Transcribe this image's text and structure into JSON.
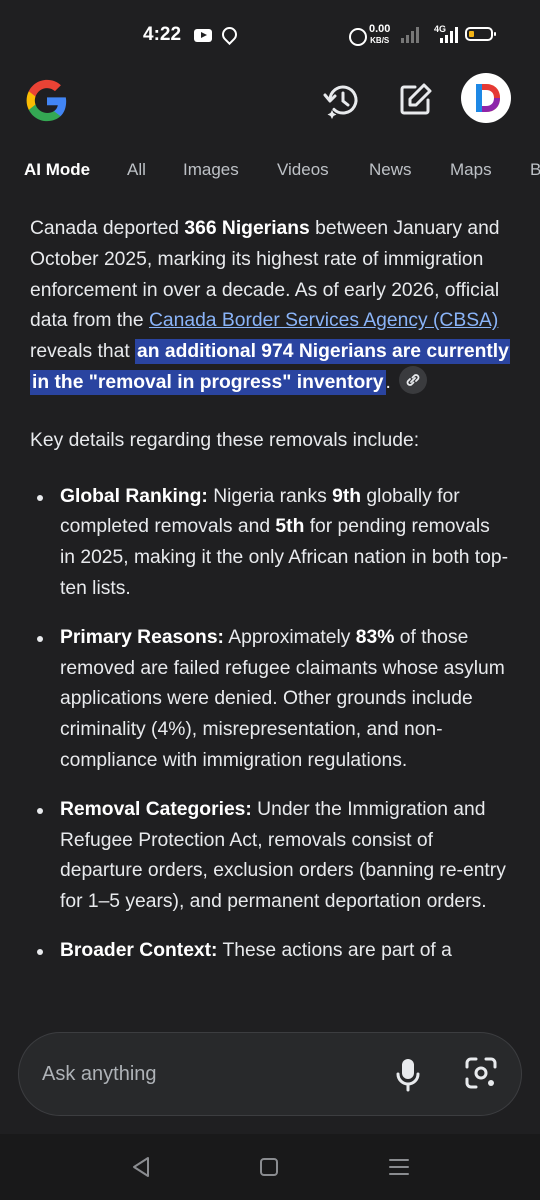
{
  "status_bar": {
    "time": "4:22",
    "speed_value": "0.00",
    "speed_unit": "KB/S",
    "network": "4G",
    "icons": [
      "youtube-icon",
      "location-icon",
      "alarm-icon",
      "signal-icon",
      "battery-icon"
    ]
  },
  "header": {
    "logo": "google-logo",
    "icons": [
      "history-icon",
      "edit-icon",
      "avatar"
    ],
    "avatar_letter": "D"
  },
  "tabs": [
    "AI Mode",
    "All",
    "Images",
    "Videos",
    "News",
    "Maps",
    "B"
  ],
  "active_tab": "AI Mode",
  "content": {
    "p1_a": "Canada deported ",
    "p1_b": "366 Nigerians",
    "p1_c": " between January and October 2025, marking its highest rate of immigration enforcement in over a decade. As of early 2026, official data from the ",
    "p1_link": "Canada Border Services Agency (CBSA)",
    "p1_d": " reveals that ",
    "p1_highlight": "an additional 974 Nigerians are currently in the \"removal in progress\" inventory",
    "p1_e": ".",
    "p2": "Key details regarding these removals include:",
    "bullets": [
      {
        "title": "Global Ranking:",
        "parts": [
          " Nigeria ranks ",
          "9th",
          " globally for completed removals and ",
          "5th",
          " for pending removals in 2025, making it the only African nation in both top-ten lists."
        ]
      },
      {
        "title": "Primary Reasons:",
        "parts": [
          " Approximately ",
          "83%",
          " of those removed are failed refugee claimants whose asylum applications were denied. Other grounds include criminality (4%), misrepresentation, and non-compliance with immigration regulations."
        ]
      },
      {
        "title": "Removal Categories:",
        "text": " Under the Immigration and Refugee Protection Act, removals consist of departure orders, exclusion orders (banning re-entry for 1–5 years), and permanent deportation orders."
      },
      {
        "title": "Broader Context:",
        "text": " These actions are part of a"
      }
    ]
  },
  "input": {
    "placeholder": "Ask anything"
  },
  "navbar": [
    "back-icon",
    "home-icon",
    "recents-icon"
  ],
  "colors": {
    "background": "#1f1f21",
    "link": "#8ab4f8",
    "highlight": "#2a44a0"
  }
}
